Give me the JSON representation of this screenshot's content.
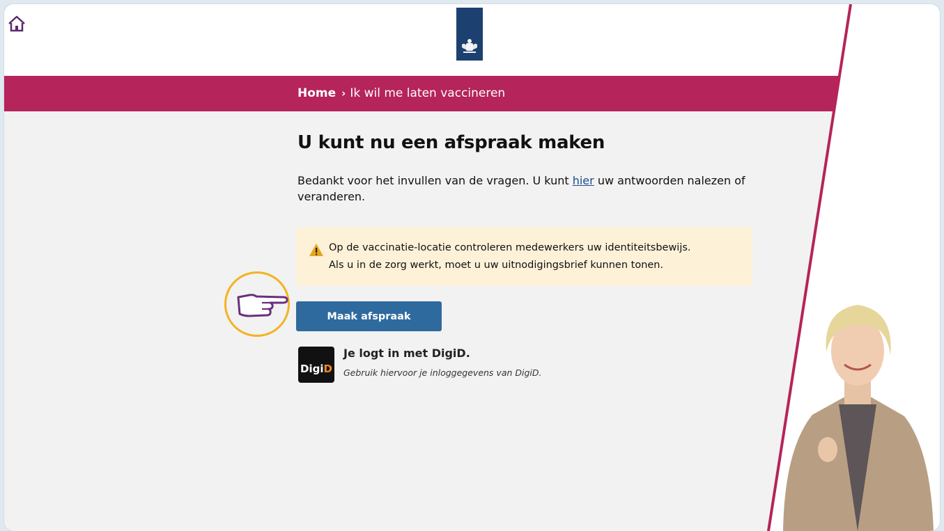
{
  "breadcrumb": {
    "home": "Home",
    "separator": "›",
    "current": "Ik wil me laten vaccineren"
  },
  "main": {
    "title": "U kunt nu een afspraak maken",
    "intro_before": "Bedankt voor het invullen van de vragen. U kunt ",
    "intro_link": "hier",
    "intro_after": " uw antwoorden nalezen of veranderen.",
    "warning_line1": "Op de vaccinatie-locatie controleren medewerkers uw identiteitsbewijs.",
    "warning_line2": "Als u in de zorg werkt, moet u uw uitnodigingsbrief kunnen tonen.",
    "button_label": "Maak afspraak"
  },
  "digid": {
    "logo_left": "Digi",
    "logo_right": "D",
    "title": "Je logt in met DigiD.",
    "subtitle": "Gebruik hiervoor je inloggegevens van DigiD."
  },
  "colors": {
    "accent": "#b5245a",
    "logo_blue": "#1c4170",
    "button": "#2f6a9e",
    "warning_bg": "#fdf1d8",
    "highlight_circle": "#f2b320"
  },
  "icons": [
    "home-icon",
    "coat-of-arms-icon",
    "warning-icon",
    "pointing-hand-icon",
    "digid-logo"
  ]
}
